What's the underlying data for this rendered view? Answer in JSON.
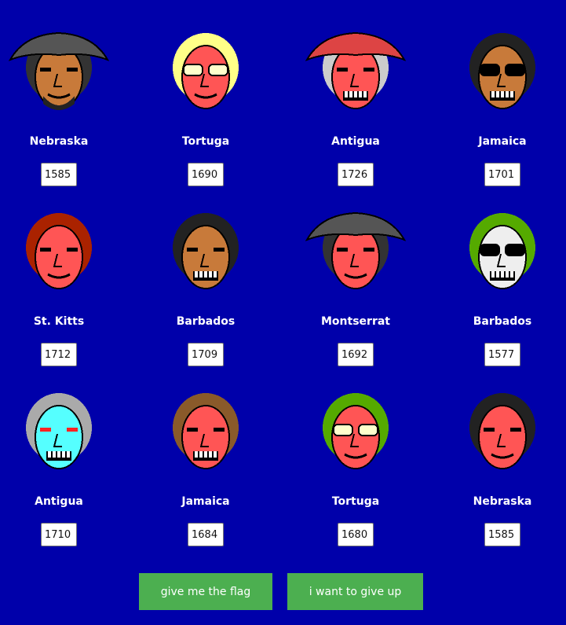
{
  "portraits": [
    {
      "place": "Nebraska",
      "year": "1585",
      "icon": "pirate-captain-tricorn-portrait",
      "skin": "#c87a3a",
      "hair": "#333333",
      "hat": "#555555",
      "feature": "beard"
    },
    {
      "place": "Tortuga",
      "year": "1690",
      "icon": "blonde-man-sunglasses-portrait",
      "skin": "#ff5555",
      "hair": "#ffff88",
      "hat": "",
      "feature": "shades"
    },
    {
      "place": "Antigua",
      "year": "1726",
      "icon": "turbaned-ghoul-portrait",
      "skin": "#ff5555",
      "hair": "#cccccc",
      "hat": "#dd4444",
      "feature": "fangs"
    },
    {
      "place": "Jamaica",
      "year": "1701",
      "icon": "half-skull-man-portrait",
      "skin": "#c87a3a",
      "hair": "#222222",
      "hat": "",
      "feature": "skull"
    },
    {
      "place": "St. Kitts",
      "year": "1712",
      "icon": "red-haired-woman-portrait",
      "skin": "#ff5555",
      "hair": "#aa2200",
      "hat": "",
      "feature": "none"
    },
    {
      "place": "Barbados",
      "year": "1709",
      "icon": "fanged-man-portrait",
      "skin": "#c87a3a",
      "hair": "#222222",
      "hat": "",
      "feature": "fangs"
    },
    {
      "place": "Montserrat",
      "year": "1692",
      "icon": "pirate-captain-tricorn-portrait",
      "skin": "#ff5555",
      "hair": "#333333",
      "hat": "#555555",
      "feature": "grin"
    },
    {
      "place": "Barbados",
      "year": "1577",
      "icon": "mohawk-skull-portrait",
      "skin": "#eeeeee",
      "hair": "#55aa00",
      "hat": "",
      "feature": "skull"
    },
    {
      "place": "Antigua",
      "year": "1710",
      "icon": "cyan-ghost-pirate-portrait",
      "skin": "#55ffff",
      "hair": "#aaaaaa",
      "hat": "",
      "feature": "ghost"
    },
    {
      "place": "Jamaica",
      "year": "1684",
      "icon": "brown-haired-ghoul-portrait",
      "skin": "#ff5555",
      "hair": "#8a5a2a",
      "hat": "",
      "feature": "fangs"
    },
    {
      "place": "Tortuga",
      "year": "1680",
      "icon": "goggled-mohawk-man-portrait",
      "skin": "#ff5555",
      "hair": "#55aa00",
      "hat": "",
      "feature": "goggles"
    },
    {
      "place": "Nebraska",
      "year": "1585",
      "icon": "dark-haired-woman-portrait",
      "skin": "#ff5555",
      "hair": "#222222",
      "hat": "",
      "feature": "none"
    }
  ],
  "buttons": {
    "flag": "give me the flag",
    "give_up": "i want to give up"
  },
  "colors": {
    "background": "#0000aa",
    "button": "#4caf50",
    "text": "#ffffff"
  }
}
